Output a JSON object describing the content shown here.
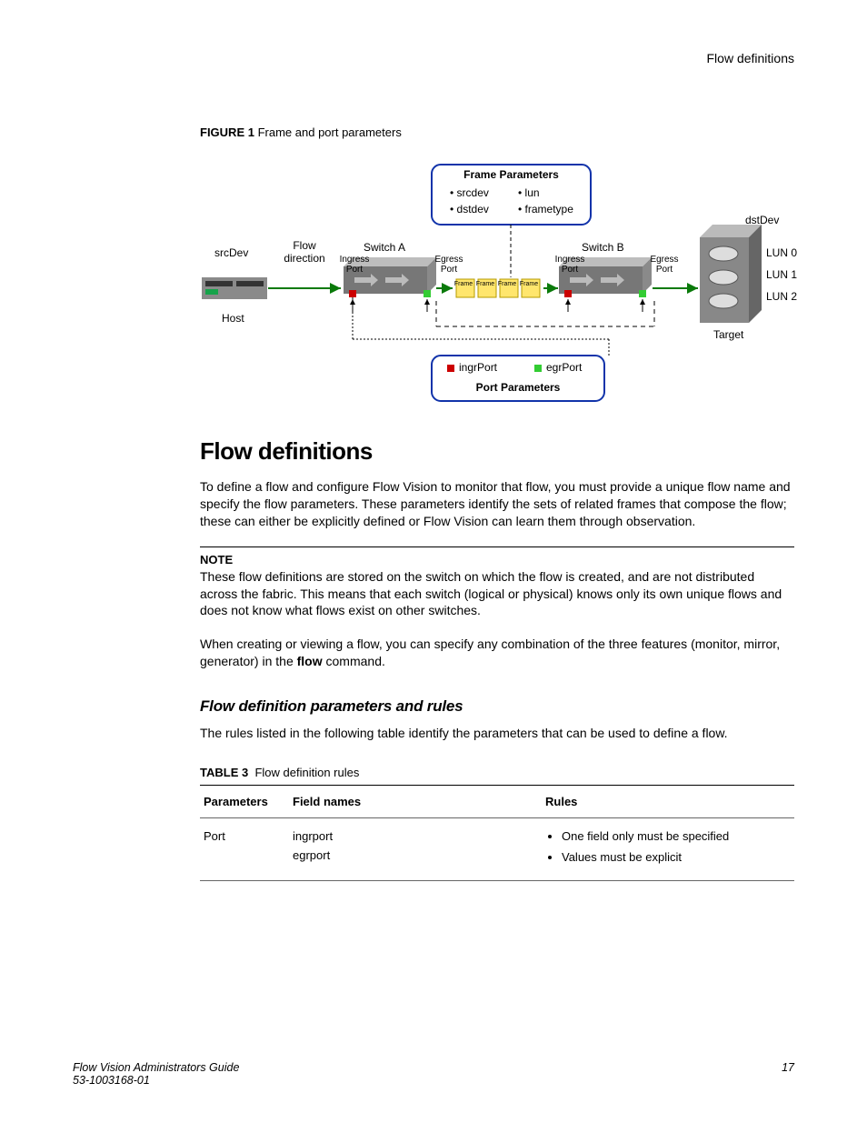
{
  "header": {
    "running_head": "Flow definitions"
  },
  "figure": {
    "label": "FIGURE 1",
    "title": "Frame and port parameters",
    "diagram": {
      "frame_params_title": "Frame Parameters",
      "frame_params_items": [
        "srcdev",
        "lun",
        "dstdev",
        "frametype"
      ],
      "port_params_title": "Port Parameters",
      "port_params_items": [
        "ingrPort",
        "egrPort"
      ],
      "srcDev": "srcDev",
      "host": "Host",
      "flow_direction": "Flow\ndirection",
      "switch_a": "Switch A",
      "switch_b": "Switch B",
      "ingress_port": "Ingress\nPort",
      "egress_port": "Egress\nPort",
      "frame": "Frame",
      "dstDev": "dstDev",
      "target": "Target",
      "luns": [
        "LUN 0",
        "LUN 1",
        "LUN 2"
      ]
    }
  },
  "section": {
    "heading": "Flow definitions",
    "para1": "To define a flow and configure Flow Vision to monitor that flow, you must provide a unique flow name and specify the flow parameters. These parameters identify the sets of related frames that compose the flow; these can either be explicitly defined or Flow Vision can learn them through observation.",
    "note_head": "NOTE",
    "note_body": "These flow definitions are stored on the switch on which the flow is created, and are not distributed across the fabric. This means that each switch (logical or physical) knows only its own unique flows and does not know what flows exist on other switches.",
    "para2_pre": "When creating or viewing a flow, you can specify any combination of the three features (monitor, mirror, generator) in the ",
    "para2_bold": "flow",
    "para2_post": " command.",
    "subheading": "Flow definition parameters and rules",
    "para3": "The rules listed in the following table identify the parameters that can be used to define a flow."
  },
  "table": {
    "label": "TABLE 3",
    "title": "Flow definition rules",
    "headers": [
      "Parameters",
      "Field names",
      "Rules"
    ],
    "row": {
      "param": "Port",
      "field1": "ingrport",
      "field2": "egrport",
      "rule1": "One field only must be specified",
      "rule2": "Values must be explicit"
    }
  },
  "footer": {
    "line1": "Flow Vision Administrators Guide",
    "line2": "53-1003168-01",
    "page": "17"
  }
}
